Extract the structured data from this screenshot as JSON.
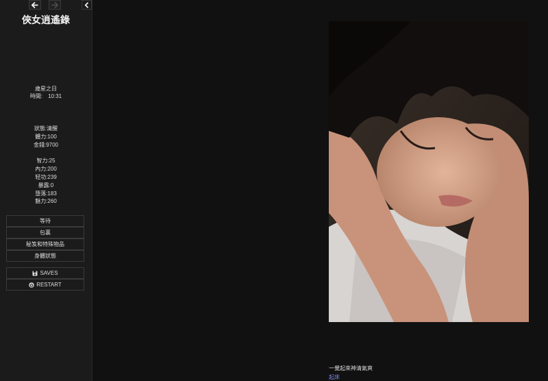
{
  "sidebar": {
    "title": "俠女逍遙錄",
    "history": {
      "back_icon": "arrow-left-icon",
      "forward_icon": "arrow-right-icon"
    },
    "toggle_icon": "chevron-left-icon",
    "date_label": "歲星之日",
    "time_line": "時間:　10:31",
    "status": {
      "state": "狀態:清醒",
      "stamina": "體力:100",
      "money": "金錢:9700",
      "intellect": "智力:25",
      "inner_power": "內力:200",
      "lightness": "轻功:239",
      "exposure": "暴露:0",
      "corruption": "墮落:183",
      "charm": "魅力:260"
    },
    "menu": [
      {
        "label": "等待"
      },
      {
        "label": "包裏"
      },
      {
        "label": "秘笈和特殊物品"
      },
      {
        "label": "身體狀態"
      }
    ],
    "saves": {
      "label": "SAVES",
      "icon": "floppy-disk-icon"
    },
    "restart": {
      "label": "RESTART",
      "icon": "power-icon"
    }
  },
  "main": {
    "image_subject": "sleeping-woman-photo",
    "narration": "一覺起來神清氣爽",
    "link": "起床"
  },
  "colors": {
    "background": "#111111",
    "sidebar": "#1b1b1b",
    "link": "#7b8be0"
  }
}
